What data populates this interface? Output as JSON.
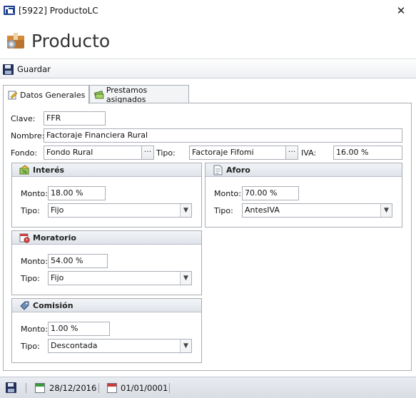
{
  "window": {
    "title": "[5922] ProductoLC",
    "close_glyph": "✕"
  },
  "header": {
    "title": "Producto",
    "icon": "product-box-icon"
  },
  "toolbar": {
    "save_label": "Guardar",
    "save_icon": "floppy-disk-icon"
  },
  "tabs": [
    {
      "label": "Datos Generales",
      "icon": "edit-document-icon",
      "active": true
    },
    {
      "label": "Prestamos asignados",
      "icon": "money-stack-icon",
      "active": false
    }
  ],
  "form": {
    "clave_label": "Clave:",
    "clave_value": "FFR",
    "nombre_label": "Nombre:",
    "nombre_value": "Factoraje Financiera Rural",
    "fondo_label": "Fondo:",
    "fondo_value": "Fondo Rural",
    "tipo_label": "Tipo:",
    "tipo_value": "Factoraje Fifomi",
    "iva_label": "IVA:",
    "iva_value": "16.00 %",
    "ellipsis": "···"
  },
  "groups": {
    "interes": {
      "title": "Interés",
      "icon": "interest-icon",
      "monto_label": "Monto:",
      "monto_value": "18.00 %",
      "tipo_label": "Tipo:",
      "tipo_value": "Fijo"
    },
    "aforo": {
      "title": "Aforo",
      "icon": "document-icon",
      "monto_label": "Monto:",
      "monto_value": "70.00 %",
      "tipo_label": "Tipo:",
      "tipo_value": "AntesIVA"
    },
    "moratorio": {
      "title": "Moratorio",
      "icon": "calendar-clock-icon",
      "monto_label": "Monto:",
      "monto_value": "54.00 %",
      "tipo_label": "Tipo:",
      "tipo_value": "Fijo"
    },
    "comision": {
      "title": "Comisión",
      "icon": "tag-icon",
      "monto_label": "Monto:",
      "monto_value": "1.00 %",
      "tipo_label": "Tipo:",
      "tipo_value": "Descontada"
    }
  },
  "statusbar": {
    "created_date": "28/12/2016",
    "modified_date": "01/01/0001"
  },
  "colors": {
    "accent": "#1d3f8f",
    "border": "#a8adb4",
    "group_header": "#dfe3e9"
  }
}
